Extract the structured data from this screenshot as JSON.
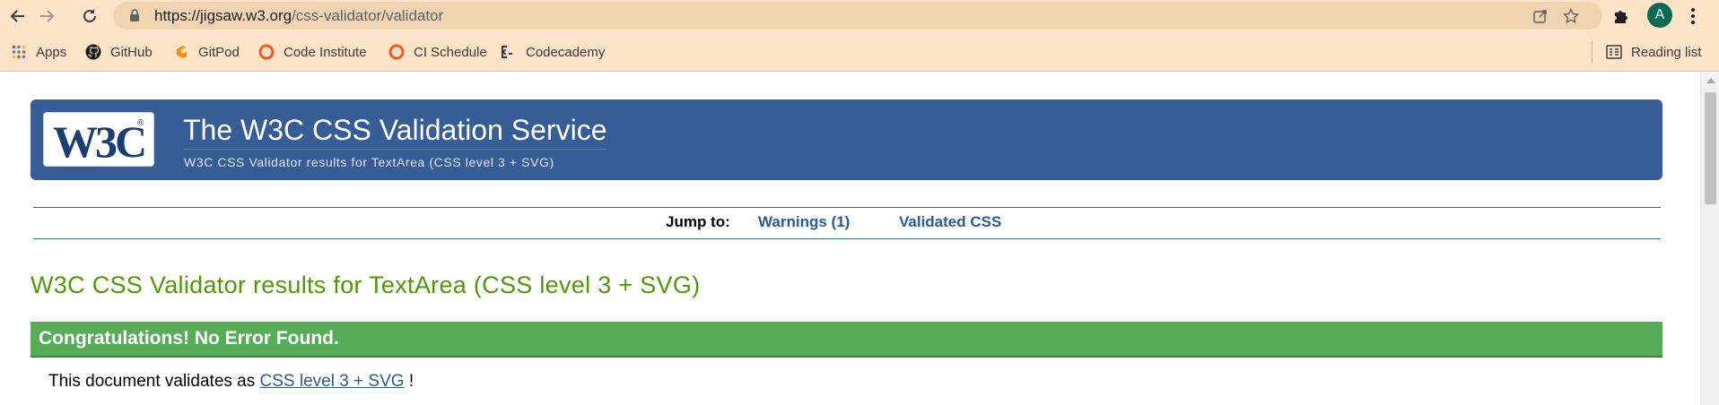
{
  "browser": {
    "url_host": "https://jigsaw.w3.org",
    "url_path": "/css-validator/validator",
    "avatar_letter": "A",
    "bookmarks": [
      {
        "label": "Apps",
        "icon": "apps-grid-icon"
      },
      {
        "label": "GitHub",
        "icon": "github-icon"
      },
      {
        "label": "GitPod",
        "icon": "gitpod-icon"
      },
      {
        "label": "Code Institute",
        "icon": "code-institute-icon"
      },
      {
        "label": "CI Schedule",
        "icon": "ci-schedule-icon"
      },
      {
        "label": "Codecademy",
        "icon": "codecademy-icon"
      }
    ],
    "reading_list": "Reading list"
  },
  "header": {
    "logo_text": "W3C",
    "logo_reg": "®",
    "title": "The W3C CSS Validation Service",
    "subtitle": "W3C CSS Validator results for TextArea (CSS level 3 + SVG)"
  },
  "jump": {
    "label": "Jump to:",
    "links": [
      "Warnings (1)",
      "Validated CSS"
    ]
  },
  "results": {
    "title": "W3C CSS Validator results for TextArea (CSS level 3 + SVG)",
    "congrats": "Congratulations! No Error Found.",
    "validates_prefix": "This document validates as",
    "validates_link": "CSS level 3 + SVG",
    "validates_suffix": "!"
  },
  "colors": {
    "chrome_bg": "#fde3c7",
    "banner": "#365d95",
    "success": "#57ad57",
    "results_title": "#4e9a06",
    "link": "#2b5b97"
  }
}
